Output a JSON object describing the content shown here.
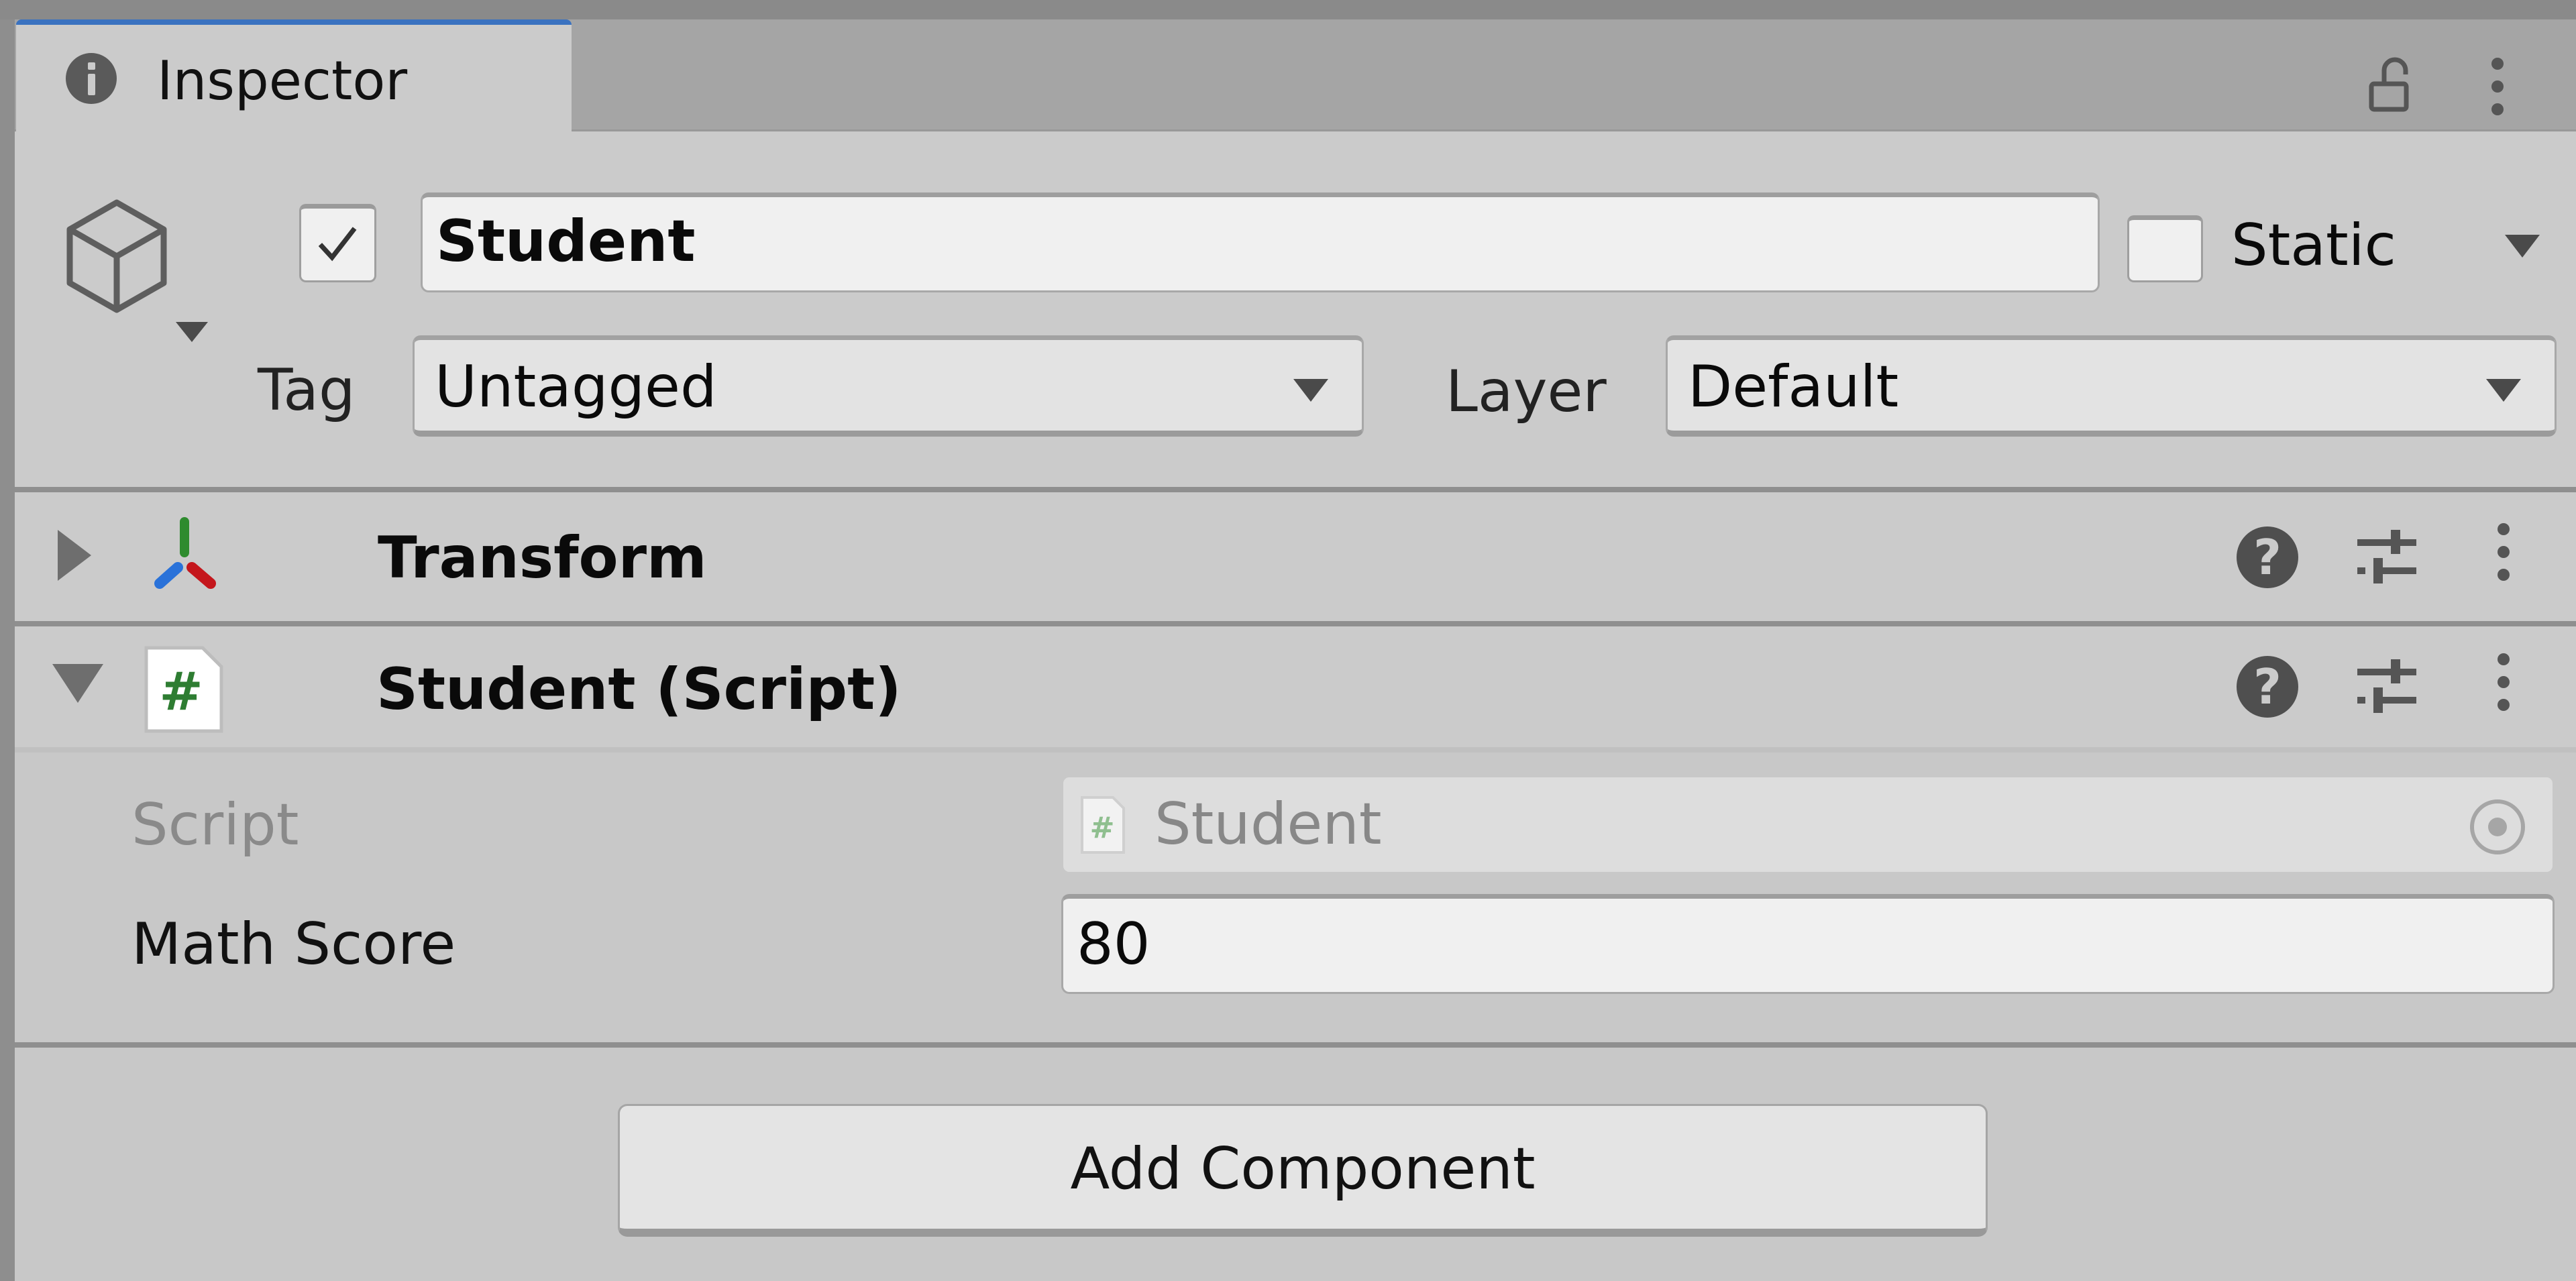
{
  "window": {
    "tab_label": "Inspector",
    "tab_icon": "info-icon",
    "lock_icon": "unlock-icon",
    "menu_icon": "kebab-menu-icon"
  },
  "gameobject": {
    "icon": "cube-icon",
    "active": true,
    "name": "Student",
    "static_checked": false,
    "static_label": "Static",
    "tag_label": "Tag",
    "tag_value": "Untagged",
    "layer_label": "Layer",
    "layer_value": "Default"
  },
  "components": [
    {
      "title": "Transform",
      "icon": "transform-axes-icon",
      "expanded": false
    },
    {
      "title": "Student (Script)",
      "icon": "csharp-script-icon",
      "expanded": true,
      "fields": [
        {
          "label": "Script",
          "value": "Student",
          "disabled": true,
          "kind": "object-reference"
        },
        {
          "label": "Math Score",
          "value": "80",
          "disabled": false,
          "kind": "int"
        }
      ]
    }
  ],
  "footer": {
    "add_component_label": "Add Component"
  },
  "colors": {
    "tab_accent": "#3a72c0",
    "panel_bg": "#cbcbcb",
    "axis_x": "#c4161c",
    "axis_y": "#2e8b2e",
    "axis_z": "#2a72d9",
    "script_hash": "#2e7d32"
  }
}
